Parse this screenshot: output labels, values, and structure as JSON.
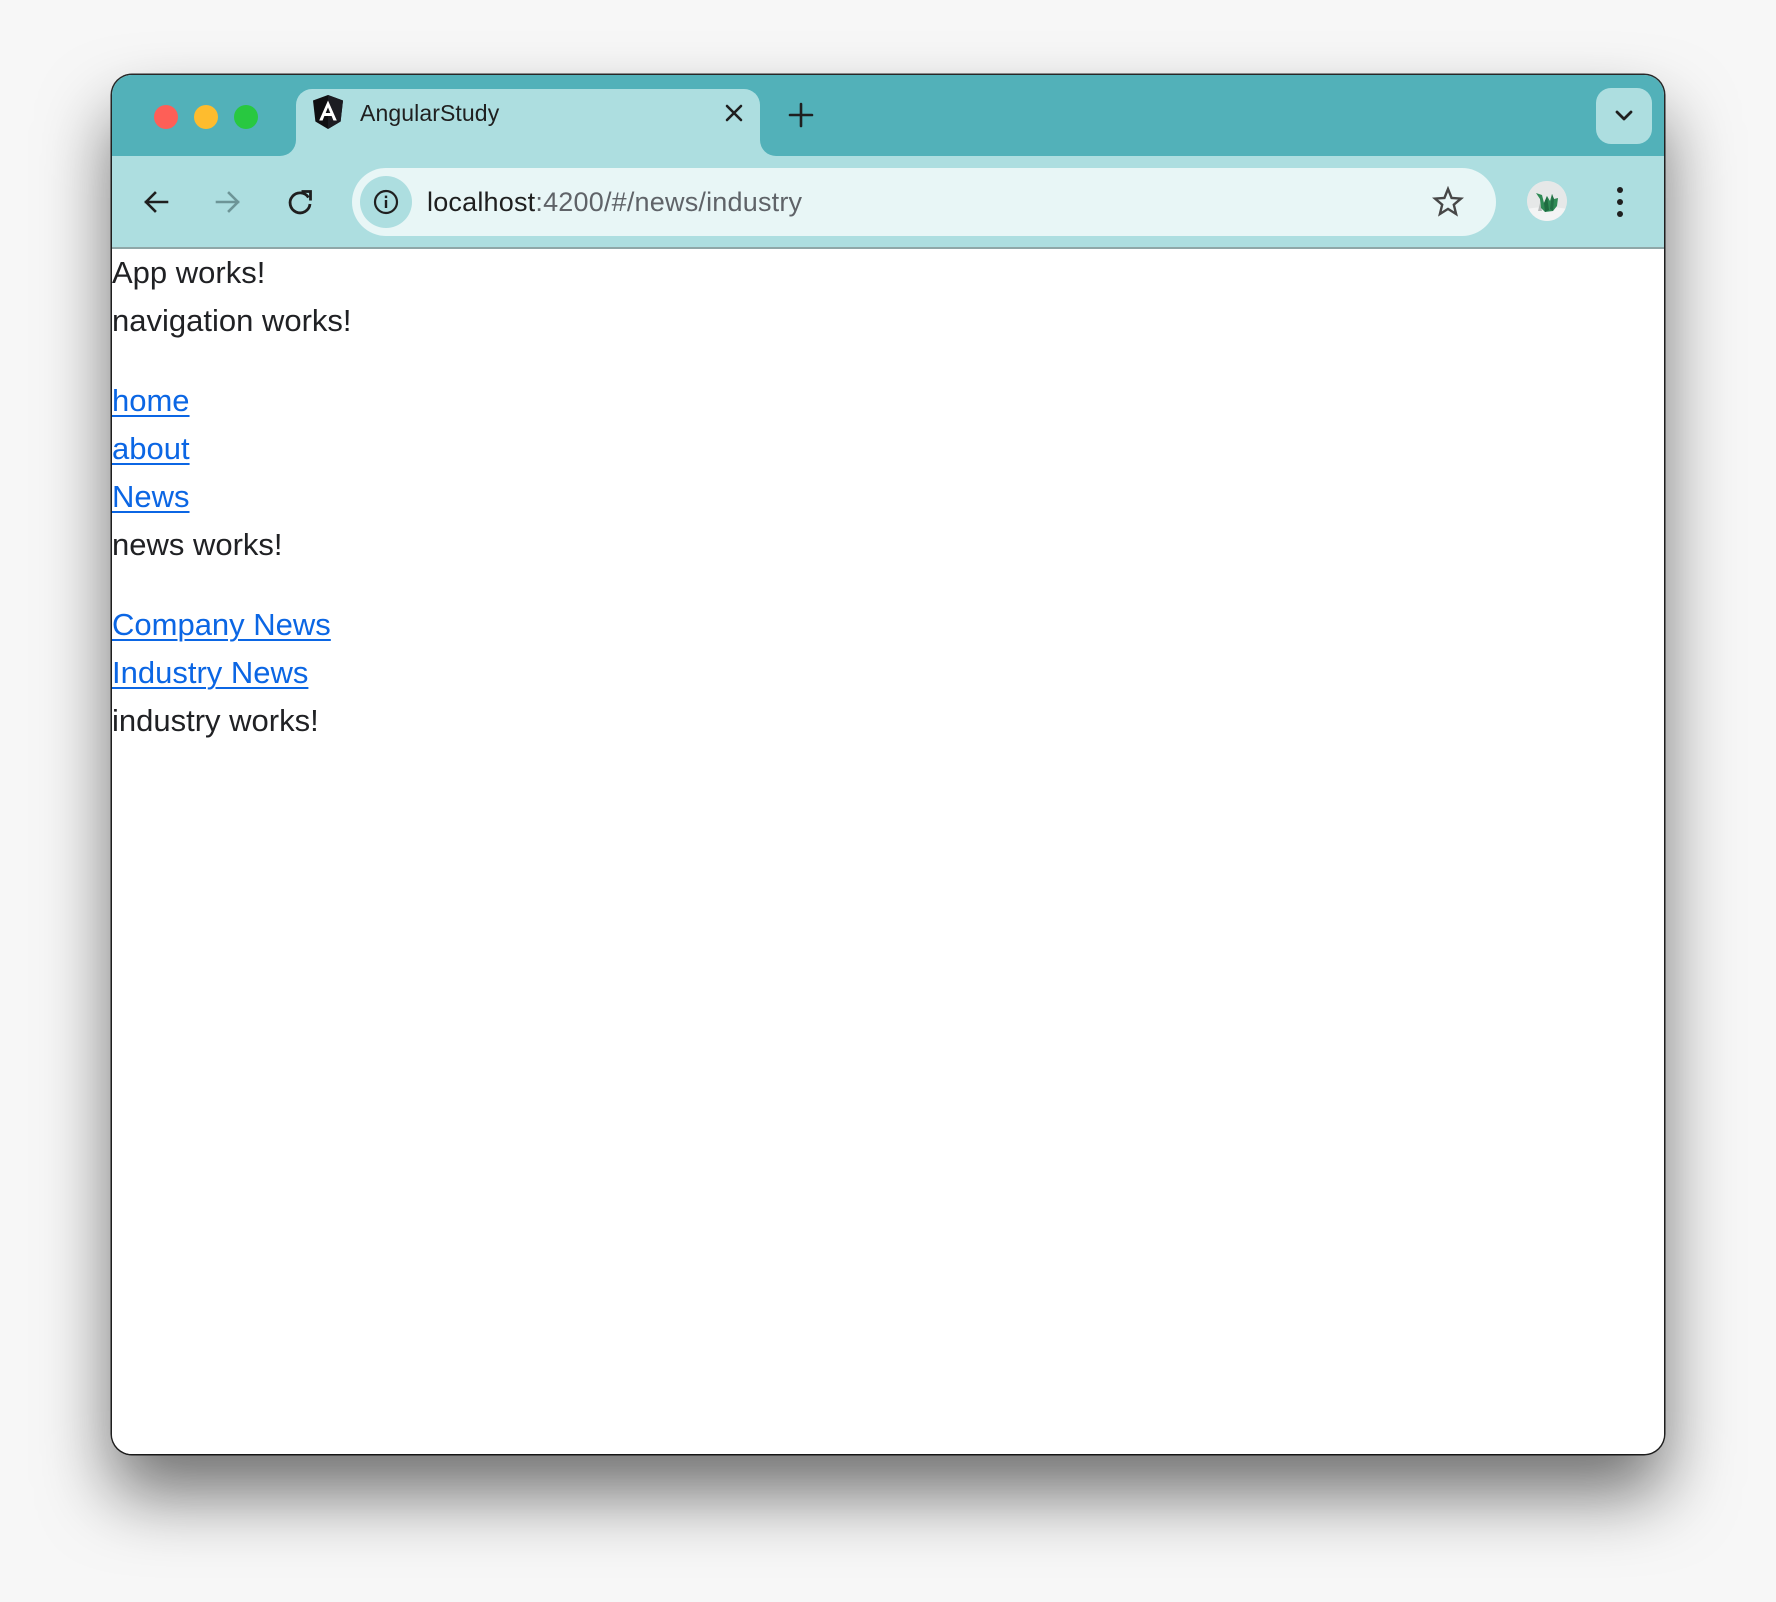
{
  "browser": {
    "tab": {
      "title": "AngularStudy",
      "favicon": "angular-icon"
    },
    "address_bar": {
      "host": "localhost",
      "path": ":4200/#/news/industry"
    },
    "icons": {
      "back": "arrow-left-icon",
      "forward": "arrow-right-icon",
      "reload": "reload-icon",
      "site_info": "info-icon",
      "bookmark": "star-icon",
      "profile": "avatar",
      "menu": "kebab-menu-icon",
      "new_tab": "plus-icon",
      "close_tab": "close-icon",
      "tab_search": "chevron-down-icon"
    },
    "colors": {
      "tabstrip": "#52b1b9",
      "toolbar": "#addee0",
      "omnibox": "#e8f6f6",
      "link": "#0b66e4",
      "text": "#202124"
    }
  },
  "page": {
    "app_status": "App works!",
    "navigation_status": "navigation works!",
    "nav_links": [
      {
        "label": "home"
      },
      {
        "label": "about"
      },
      {
        "label": "News"
      }
    ],
    "news_status": "news works!",
    "news_links": [
      {
        "label": "Company News"
      },
      {
        "label": "Industry News"
      }
    ],
    "industry_status": "industry works!"
  }
}
